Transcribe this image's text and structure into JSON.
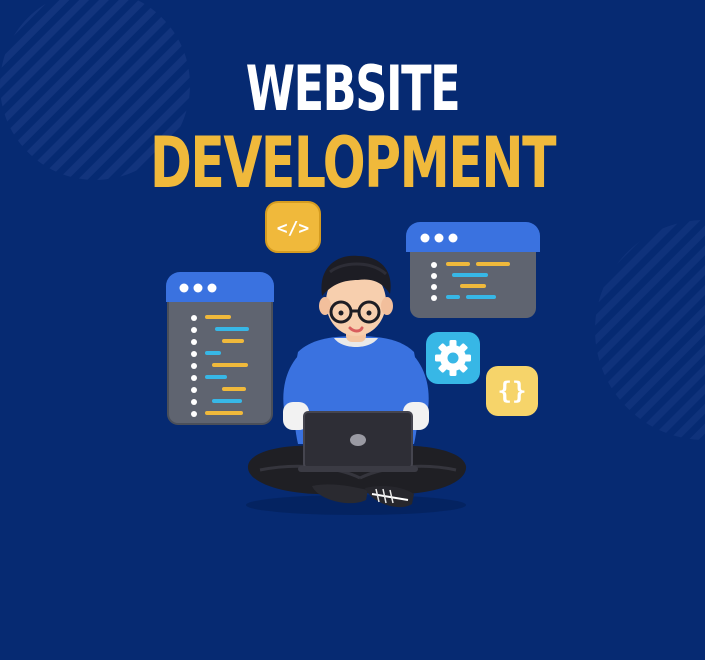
{
  "heading": {
    "line1": "WEBSITE",
    "line2": "DEVELOPMENT"
  },
  "badges": {
    "code_tag": "</>",
    "braces": "{}"
  },
  "colors": {
    "background": "#062a72",
    "accent_yellow": "#f0b93b",
    "accent_blue": "#3a72e0",
    "code_cyan": "#37b7e6",
    "panel_gray": "#5f6470"
  },
  "icons": [
    "code-tag-icon",
    "gear-icon",
    "curly-braces-icon",
    "laptop-icon",
    "window-dots-icon"
  ]
}
